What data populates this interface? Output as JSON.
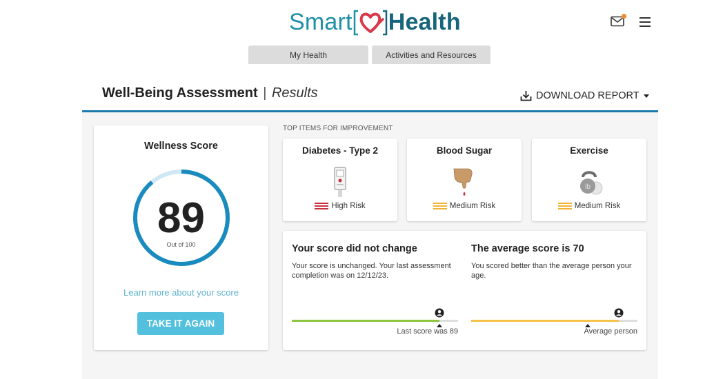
{
  "header": {
    "logo_smart": "Smart",
    "logo_health": "Health",
    "icons": {
      "mail": "mail-icon",
      "menu": "hamburger-menu-icon",
      "logo": "heart-icon"
    },
    "colors": {
      "brand": "#1d8fa6",
      "brand_dark": "#16657a",
      "heart": "#d93a4a",
      "notification": "#f28c28"
    }
  },
  "tabs": [
    {
      "label": "My Health"
    },
    {
      "label": "Activities and Resources"
    }
  ],
  "page": {
    "title": "Well-Being Assessment",
    "separator": "|",
    "subtitle": "Results",
    "download_label": "DOWNLOAD REPORT",
    "accent_color": "#1a7aad"
  },
  "wellness": {
    "title": "Wellness Score",
    "score": "89",
    "out_of": "Out of 100",
    "score_fraction": 0.89,
    "learn_more": "Learn more about your score",
    "take_again": "TAKE IT AGAIN",
    "colors": {
      "ring": "#1a8bbf",
      "ring_track": "#cfe8f3",
      "button": "#53c0de",
      "link": "#5fb4cf"
    }
  },
  "top_items": {
    "label": "TOP ITEMS FOR IMPROVEMENT",
    "items": [
      {
        "title": "Diabetes - Type 2",
        "risk": "High Risk",
        "icon": "glucose-meter-icon",
        "risk_color": "#c9303e"
      },
      {
        "title": "Blood Sugar",
        "risk": "Medium Risk",
        "icon": "finger-blood-drop-icon",
        "risk_color": "#f2b233"
      },
      {
        "title": "Exercise",
        "risk": "Medium Risk",
        "icon": "kettlebell-icon",
        "risk_color": "#f2b233"
      }
    ]
  },
  "comparison": {
    "change": {
      "title": "Your score did not change",
      "text": "Your score is unchanged. Your last assessment completion was on 12/12/23.",
      "caption": "Last score was 89",
      "bar_fraction": 0.89,
      "bar_color": "#8cc63f"
    },
    "average": {
      "title": "The average score is 70",
      "text": "You scored better than the average person your age.",
      "caption": "Average person",
      "bar_fraction": 0.89,
      "marker_fraction": 0.7,
      "bar_color": "#f5c24a"
    }
  }
}
